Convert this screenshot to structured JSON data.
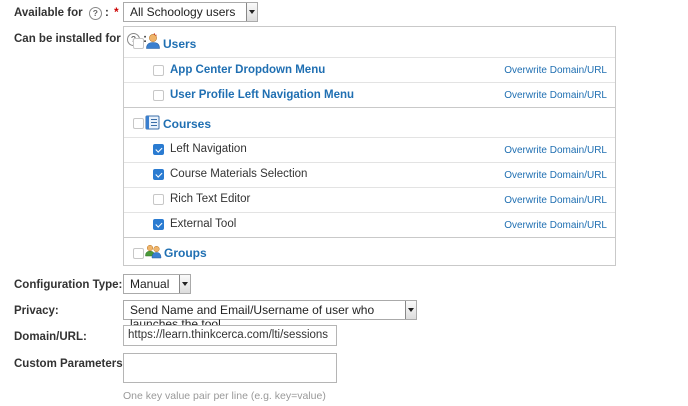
{
  "available_for": {
    "label": "Available for",
    "help": "?",
    "required": "*",
    "colon": ":",
    "value": "All Schoology users"
  },
  "installed_for": {
    "label": "Can be installed for",
    "help": "?",
    "required": "*",
    "colon": ":",
    "override_label": "Overwrite Domain/URL",
    "groups": {
      "users": {
        "label": "Users",
        "icon": "user-icon",
        "items": [
          {
            "label": "App Center Dropdown Menu",
            "checked": false
          },
          {
            "label": "User Profile Left Navigation Menu",
            "checked": false
          }
        ]
      },
      "courses": {
        "label": "Courses",
        "icon": "course-icon",
        "items": [
          {
            "label": "Left Navigation",
            "checked": true
          },
          {
            "label": "Course Materials Selection",
            "checked": true
          },
          {
            "label": "Rich Text Editor",
            "checked": false
          },
          {
            "label": "External Tool",
            "checked": true
          }
        ]
      },
      "groups": {
        "label": "Groups",
        "icon": "groups-icon"
      }
    }
  },
  "configuration_type": {
    "label": "Configuration Type:",
    "value": "Manual"
  },
  "privacy": {
    "label": "Privacy:",
    "value": "Send Name and Email/Username of user who launches the tool"
  },
  "domain_url": {
    "label": "Domain/URL:",
    "value": "https://learn.thinkcerca.com/lti/sessions"
  },
  "custom_parameters": {
    "label": "Custom Parameters:",
    "value": "",
    "hint": "One key value pair per line (e.g. key=value)"
  },
  "colors": {
    "link": "#1f6fb2",
    "checkbox_checked": "#2a7bd1",
    "required": "#cc0000"
  }
}
